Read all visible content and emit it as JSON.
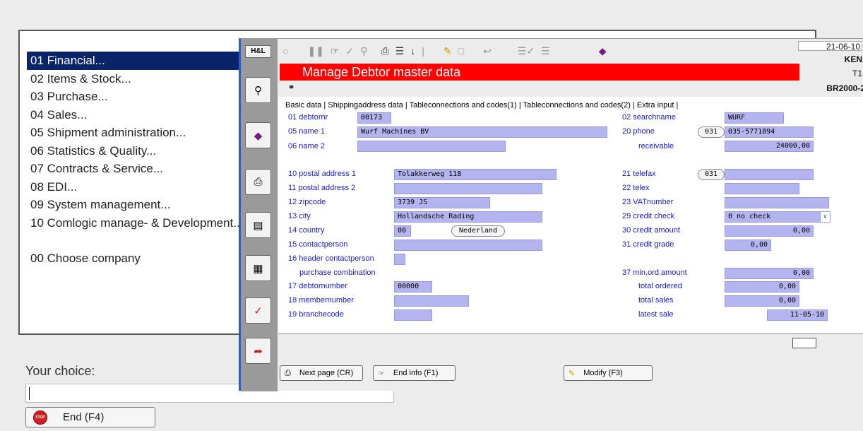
{
  "menu": {
    "items": [
      "01 Financial...",
      "02 Items & Stock...",
      "03 Purchase...",
      "04 Sales...",
      "05 Shipment administration...",
      "06 Statistics & Quality...",
      "07 Contracts & Service...",
      "08 EDI...",
      "09 System management...",
      "10 Comlogic manage- & Development..."
    ],
    "company": "00 Choose company",
    "selected_index": 0
  },
  "choice": {
    "label": "Your choice:",
    "value": ""
  },
  "end_button": {
    "label": "End (F4)",
    "icon": "stop-icon"
  },
  "window": {
    "hl_label": "H&L",
    "title": "Manage Debtor  master data",
    "title_bar_color": "#ff0000",
    "info": {
      "date": "21-06-10",
      "user": "KEN",
      "terminal": "T1",
      "code": "BR2000-2"
    },
    "tabs": [
      "Basic data",
      "Shippingaddress data",
      "Tableconnections and codes(1)",
      "Tableconnections and codes(2)",
      "Extra input"
    ],
    "sidebar_icons": [
      "search-icon",
      "book-icon",
      "print-icon",
      "document-icon",
      "calculator-icon",
      "hand-icon",
      "exit-icon"
    ],
    "toolbar_icons": [
      "circle-icon",
      "pause-icon",
      "hand-icon",
      "check-icon",
      "pin-icon",
      "print-icon",
      "list-icon",
      "next-page-icon",
      "separator-icon",
      "edit-icon",
      "blank-icon",
      "pin-icon",
      "list-check-icon",
      "list-check-icon",
      "book-icon"
    ]
  },
  "form": {
    "left": [
      {
        "label": "01 debtornr",
        "value": "00173"
      },
      {
        "label": "05 name 1",
        "value": "Wurf Machines BV"
      },
      {
        "label": "06 name 2",
        "value": ""
      },
      {
        "label": "10 postal address 1",
        "value": "Tolakkerweg 118"
      },
      {
        "label": "11 postal address 2",
        "value": ""
      },
      {
        "label": "12 zipcode",
        "value": "3739 JS"
      },
      {
        "label": "13 city",
        "value": "Hollandsche Rading"
      },
      {
        "label": "14 country",
        "value": "00",
        "country_name": "Nederland"
      },
      {
        "label": "15 contactperson",
        "value": ""
      },
      {
        "label": "16 header contactperson",
        "value": ""
      },
      {
        "label": "purchase combination"
      },
      {
        "label": "17 debtornumber",
        "value": "00000"
      },
      {
        "label": "18 membernumber",
        "value": ""
      },
      {
        "label": "19 branchecode",
        "value": ""
      }
    ],
    "right": [
      {
        "label": "02 searchname",
        "value": "WURF"
      },
      {
        "label": "20 phone",
        "prefix": "031",
        "value": "035-5771894"
      },
      {
        "label": "receivable",
        "value": "24000,00"
      },
      {
        "label": "21 telefax",
        "prefix": "031",
        "value": ""
      },
      {
        "label": "22 telex",
        "value": ""
      },
      {
        "label": "23 VATnumber",
        "value": ""
      },
      {
        "label": "29 credit check",
        "value": "0 no check"
      },
      {
        "label": "30 credit amount",
        "value": "0,00"
      },
      {
        "label": "31 credit grade",
        "value": "0,00"
      },
      {
        "label": "37 min.ord.amount",
        "value": "0,00"
      },
      {
        "label": "total ordered",
        "value": "0,00"
      },
      {
        "label": "total sales",
        "value": "0,00"
      },
      {
        "label": "latest sale",
        "value": "11-05-10"
      }
    ]
  },
  "bottom_buttons": {
    "next": {
      "label": "Next page (CR)",
      "icon": "next-page-icon"
    },
    "info": {
      "label": "End info (F1)",
      "icon": "hand-icon"
    },
    "modify": {
      "label": "Modify (F3)",
      "icon": "edit-icon"
    }
  }
}
